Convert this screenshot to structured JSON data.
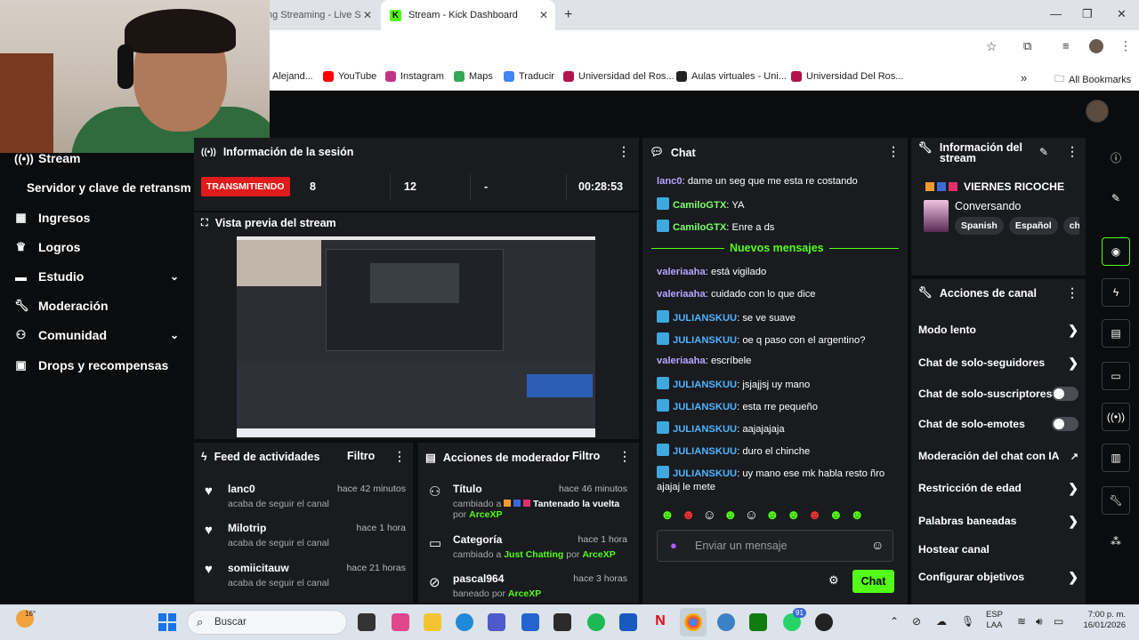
{
  "browser": {
    "tabs": [
      {
        "label": "ng Streaming - Live S"
      },
      {
        "label": "Stream - Kick Dashboard"
      }
    ],
    "bookmarks": [
      "Alejand...",
      "YouTube",
      "Instagram",
      "Maps",
      "Traducir",
      "Universidad del Ros...",
      "Aulas virtuales - Uni...",
      "Universidad Del Ros..."
    ],
    "all_bookmarks": "All Bookmarks",
    "more": "»"
  },
  "sidebar": {
    "items": [
      {
        "label": "Stream",
        "icon": "broadcast-icon"
      },
      {
        "label": "Servidor y clave de retransm",
        "icon": ""
      },
      {
        "label": "Ingresos",
        "icon": "bank-icon"
      },
      {
        "label": "Logros",
        "icon": "trophy-icon"
      },
      {
        "label": "Estudio",
        "icon": "palette-icon"
      },
      {
        "label": "Moderación",
        "icon": "wrench-icon"
      },
      {
        "label": "Comunidad",
        "icon": "users-icon"
      },
      {
        "label": "Drops y recompensas",
        "icon": "gift-icon"
      }
    ]
  },
  "session": {
    "title": "Información de la sesión",
    "status": "TRANSMITIENDO",
    "stats": [
      "8",
      "12",
      "-",
      "00:28:53"
    ]
  },
  "preview": {
    "title": "Vista previa del stream"
  },
  "feed": {
    "title": "Feed de actividades",
    "filter": "Filtro",
    "items": [
      {
        "user": "lanc0",
        "time": "hace 42 minutos",
        "text": "acaba de seguir el canal"
      },
      {
        "user": "Milotrip",
        "time": "hace 1 hora",
        "text": "acaba de seguir el canal"
      },
      {
        "user": "somiicitauw",
        "time": "hace 21 horas",
        "text": "acaba de seguir el canal"
      }
    ]
  },
  "modactions": {
    "title": "Acciones de moderador",
    "filter": "Filtro",
    "items": [
      {
        "label": "Título",
        "time": "hace 46 minutos",
        "pre": "cambiado a",
        "value": "Tantenado la vuelta",
        "by": "por",
        "mod": "ArceXP"
      },
      {
        "label": "Categoría",
        "time": "hace 1 hora",
        "pre": "cambiado a",
        "value": "Just Chatting",
        "by": "por",
        "mod": "ArceXP"
      },
      {
        "label": "pascal964",
        "time": "hace 3 horas",
        "pre": "baneado",
        "value": "",
        "by": "por",
        "mod": "ArceXP"
      }
    ]
  },
  "chat": {
    "title": "Chat",
    "new_messages": "Nuevos mensajes",
    "messages": [
      {
        "user": "lanc0",
        "text": "dame un seg que me esta re costando",
        "badge": false,
        "color": "#b8a5ff"
      },
      {
        "user": "CamiloGTX",
        "text": "YA",
        "badge": true,
        "color": "#7cff6b"
      },
      {
        "user": "CamiloGTX",
        "text": "Enre a ds",
        "badge": true,
        "color": "#7cff6b"
      },
      {
        "user": "valeriaaha",
        "text": "está vigilado",
        "badge": false,
        "color": "#b8a5ff"
      },
      {
        "user": "valeriaaha",
        "text": "cuidado con lo que dice",
        "badge": false,
        "color": "#b8a5ff"
      },
      {
        "user": "JULIANSKUU",
        "text": "se ve suave",
        "badge": true,
        "color": "#4fb4ff"
      },
      {
        "user": "JULIANSKUU",
        "text": "oe q paso con el argentino?",
        "badge": true,
        "color": "#4fb4ff"
      },
      {
        "user": "valeriaaha",
        "text": "escríbele",
        "badge": false,
        "color": "#b8a5ff"
      },
      {
        "user": "JULIANSKUU",
        "text": "jsjajjsj uy mano",
        "badge": true,
        "color": "#4fb4ff"
      },
      {
        "user": "JULIANSKUU",
        "text": "esta rre pequeño",
        "badge": true,
        "color": "#4fb4ff"
      },
      {
        "user": "JULIANSKUU",
        "text": "aajajajaja",
        "badge": true,
        "color": "#4fb4ff"
      },
      {
        "user": "JULIANSKUU",
        "text": "duro el chinche",
        "badge": true,
        "color": "#4fb4ff"
      },
      {
        "user": "JULIANSKUU",
        "text": "uy mano ese mk habla resto ñro ajajaj le mete",
        "badge": true,
        "color": "#4fb4ff"
      }
    ],
    "placeholder": "Enviar un mensaje",
    "send": "Chat"
  },
  "info": {
    "title": "Información del stream",
    "stream_title": "VIERNES RICOCHE",
    "category": "Conversando",
    "tags": [
      "Spanish",
      "Español",
      "chi"
    ]
  },
  "canal": {
    "title": "Acciones de canal",
    "items": [
      {
        "label": "Modo lento",
        "control": "arrow"
      },
      {
        "label": "Chat de solo-seguidores",
        "control": "arrow"
      },
      {
        "label": "Chat de solo-suscriptores",
        "control": "toggle"
      },
      {
        "label": "Chat de solo-emotes",
        "control": "toggle"
      },
      {
        "label": "Moderación del chat con IA",
        "control": "external"
      },
      {
        "label": "Restricción de edad",
        "control": "arrow"
      },
      {
        "label": "Palabras baneadas",
        "control": "arrow"
      },
      {
        "label": "Hostear canal",
        "control": "none"
      },
      {
        "label": "Configurar objetivos",
        "control": "arrow"
      }
    ]
  },
  "taskbar": {
    "search": "Buscar",
    "weather": "16°",
    "lang1": "ESP",
    "lang2": "LAA",
    "time": "7:00 p. m.",
    "date": "16/01/2026",
    "badge": "91"
  },
  "colors": {
    "accent": "#53fc18",
    "live": "#e01b1b",
    "panel": "#191b1f"
  }
}
